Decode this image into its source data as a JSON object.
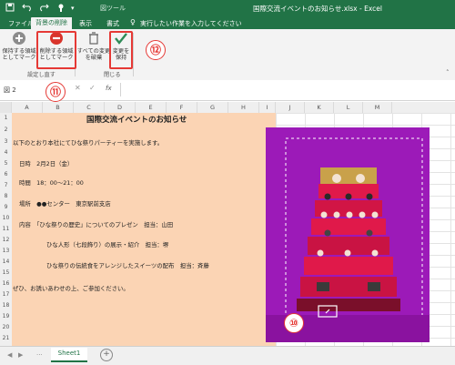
{
  "titlebar": {
    "context_tool": "図ツール",
    "title": "国際交流イベントのお知らせ.xlsx - Excel",
    "quick_access": {
      "save_icon": "save-icon",
      "undo_icon": "undo-icon",
      "redo_icon": "redo-icon"
    }
  },
  "tabs": [
    {
      "label": "ファイル",
      "active": false
    },
    {
      "label": "背景の削除",
      "active": true
    },
    {
      "label": "表示",
      "active": false
    },
    {
      "label": "書式",
      "active": false
    }
  ],
  "tell_me": "実行したい作業を入力してください",
  "ribbon": {
    "buttons": [
      {
        "label_line1": "保持する領域",
        "label_line2": "としてマーク",
        "icon": "plus-icon"
      },
      {
        "label_line1": "削除する領域",
        "label_line2": "としてマーク",
        "icon": "minus-icon"
      },
      {
        "label_line1": "すべての変更",
        "label_line2": "を破棄",
        "icon": "trash-icon"
      },
      {
        "label_line1": "変更を",
        "label_line2": "保持",
        "icon": "checkmark-icon"
      }
    ],
    "group_refine": "設定し直す",
    "group_close": "閉じる"
  },
  "formula_bar": {
    "name_box": "図 2",
    "fx_label": "fx",
    "value": ""
  },
  "columns": [
    "A",
    "B",
    "C",
    "D",
    "E",
    "F",
    "G",
    "H",
    "I",
    "J",
    "K",
    "L",
    "M"
  ],
  "rows": [
    "1",
    "2",
    "3",
    "4",
    "5",
    "6",
    "7",
    "8",
    "9",
    "10",
    "11",
    "12",
    "13",
    "14",
    "15",
    "16",
    "17",
    "18",
    "19",
    "20",
    "21"
  ],
  "sheet": {
    "title": "国際交流イベントのお知らせ",
    "lines": [
      "以下のとおり本社にてひな祭りパーティーを実施します。",
      "日時　2月2日（金）",
      "時間　18：00～21：00",
      "場所　●●センター　東京駅前支店",
      "内容　「ひな祭りの歴史」についてのプレゼン　担当：山田",
      "ひな人形（七段飾り）の展示・紹介　担当：堺",
      "ひな祭りの伝統食をアレンジしたスイーツの配布　担当：斉藤",
      "ぜひ、お誘いあわせの上、ご参加ください。"
    ]
  },
  "sheet_tab": "Sheet1",
  "badges": [
    "⑪",
    "⑫",
    "⑩"
  ],
  "colors": {
    "excel_green": "#217346",
    "highlight_red": "#e53935",
    "cell_peach": "#fbd4b4",
    "bg_removal_magenta": "#a21cbf"
  }
}
